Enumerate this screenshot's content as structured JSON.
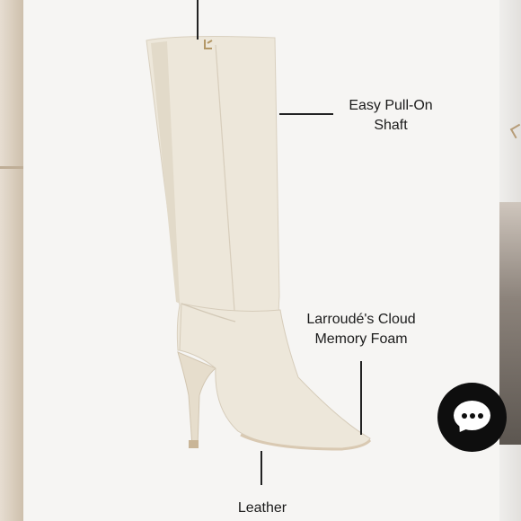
{
  "callouts": {
    "shaft_line1": "Easy Pull-On",
    "shaft_line2": "Shaft",
    "foam_line1": "Larroudé's Cloud",
    "foam_line2": "Memory Foam",
    "leather": "Leather"
  },
  "product": {
    "color_name": "ivory",
    "boot_fill": "#ece6d8",
    "sole_color": "#d9c9b2"
  },
  "chat": {
    "icon": "chat-bubble-dots-icon"
  }
}
